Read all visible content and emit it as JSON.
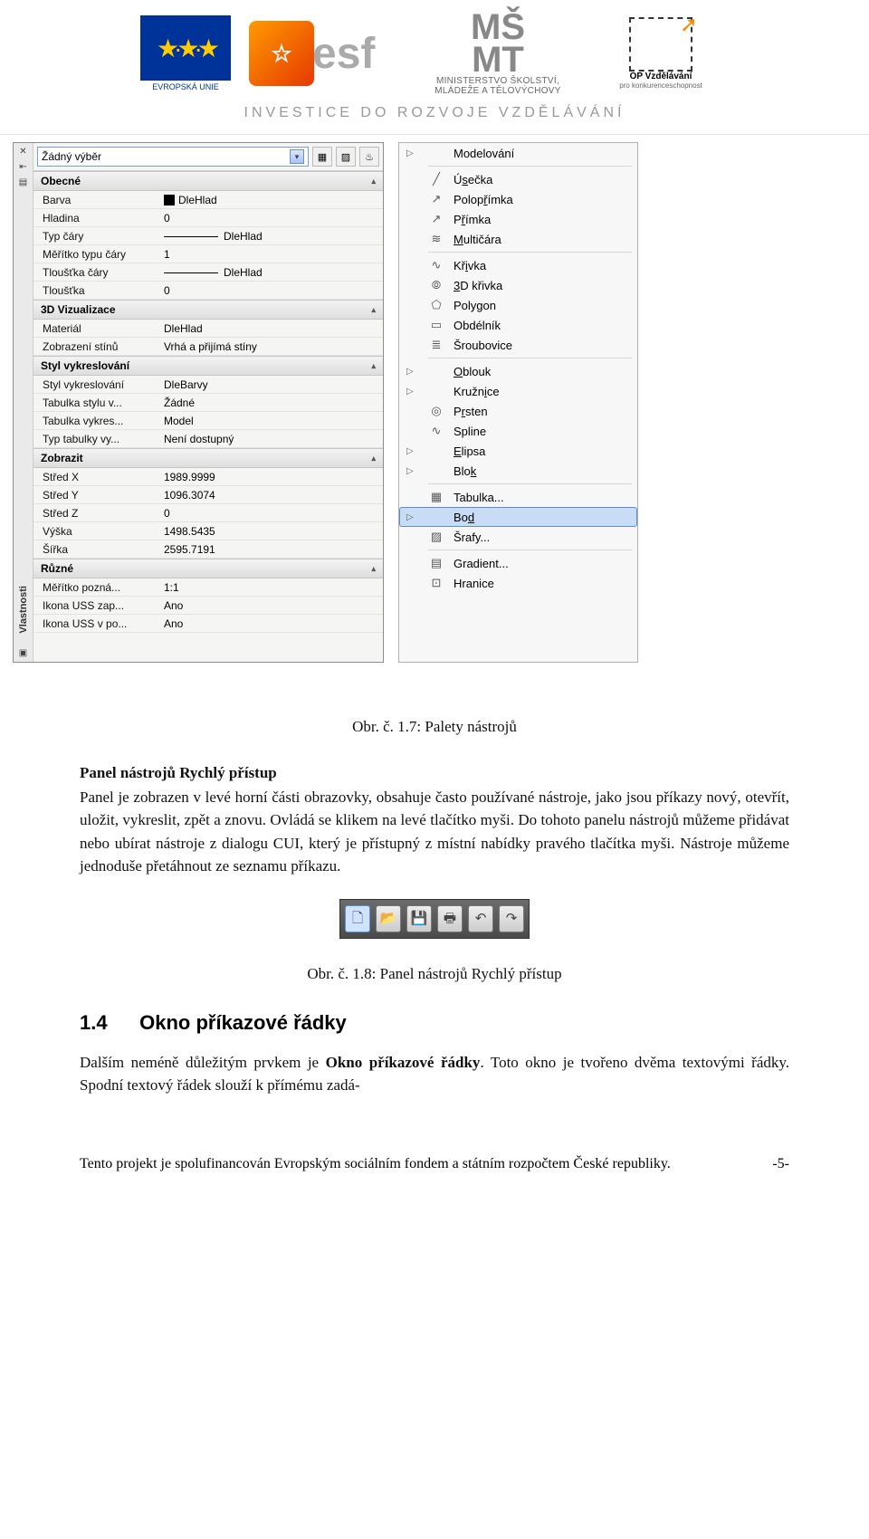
{
  "header": {
    "eu_label": "EVROPSKÁ UNIE",
    "msmt_line1": "MINISTERSTVO ŠKOLSTVÍ,",
    "msmt_line2": "MLÁDEŽE A TĚLOVÝCHOVY",
    "opvk_line1": "OP Vzdělávání",
    "opvk_line2": "pro konkurenceschopnost",
    "invest": "INVESTICE DO ROZVOJE VZDĚLÁVÁNÍ"
  },
  "props_panel": {
    "side_label": "Vlastnosti",
    "selection": "Žádný výběr",
    "categories": [
      {
        "name": "Obecné",
        "rows": [
          {
            "label": "Barva",
            "value": "DleHlad",
            "swatch": true
          },
          {
            "label": "Hladina",
            "value": "0"
          },
          {
            "label": "Typ čáry",
            "value": "DleHlad",
            "line": true
          },
          {
            "label": "Měřítko typu čáry",
            "value": "1"
          },
          {
            "label": "Tloušťka čáry",
            "value": "DleHlad",
            "line": true
          },
          {
            "label": "Tloušťka",
            "value": "0"
          }
        ]
      },
      {
        "name": "3D Vizualizace",
        "rows": [
          {
            "label": "Materiál",
            "value": "DleHlad"
          },
          {
            "label": "Zobrazení stínů",
            "value": "Vrhá a přijímá stíny"
          }
        ]
      },
      {
        "name": "Styl vykreslování",
        "rows": [
          {
            "label": "Styl vykreslování",
            "value": "DleBarvy"
          },
          {
            "label": "Tabulka stylu v...",
            "value": "Žádné"
          },
          {
            "label": "Tabulka vykres...",
            "value": "Model"
          },
          {
            "label": "Typ tabulky vy...",
            "value": "Není dostupný"
          }
        ]
      },
      {
        "name": "Zobrazit",
        "rows": [
          {
            "label": "Střed X",
            "value": "1989.9999"
          },
          {
            "label": "Střed Y",
            "value": "1096.3074"
          },
          {
            "label": "Střed Z",
            "value": "0"
          },
          {
            "label": "Výška",
            "value": "1498.5435"
          },
          {
            "label": "Šířka",
            "value": "2595.7191"
          }
        ]
      },
      {
        "name": "Různé",
        "rows": [
          {
            "label": "Měřítko pozná...",
            "value": "1:1"
          },
          {
            "label": "Ikona USS zap...",
            "value": "Ano"
          },
          {
            "label": "Ikona USS v po...",
            "value": "Ano"
          }
        ]
      }
    ]
  },
  "menu": {
    "items": [
      {
        "text": "Modelování",
        "expander": true,
        "icon": "▷"
      },
      {
        "sep": true
      },
      {
        "text": "Úsečka",
        "under": 1,
        "icon": "╱"
      },
      {
        "text": "Polopřímka",
        "under": 5,
        "icon": "↗"
      },
      {
        "text": "Přímka",
        "under": 1,
        "icon": "↗"
      },
      {
        "text": "Multičára",
        "under": 0,
        "icon": "≋"
      },
      {
        "sep": true
      },
      {
        "text": "Křivka",
        "under": 2,
        "icon": "∿"
      },
      {
        "text": "3D křivka",
        "under": 0,
        "icon": "⦾"
      },
      {
        "text": "Polygon",
        "icon": "⬠"
      },
      {
        "text": "Obdélník",
        "icon": "▭"
      },
      {
        "text": "Šroubovice",
        "icon": "≣"
      },
      {
        "sep": true
      },
      {
        "text": "Oblouk",
        "under": 0,
        "expander": true,
        "icon": "▷"
      },
      {
        "text": "Kružnice",
        "under": 5,
        "expander": true,
        "icon": "▷"
      },
      {
        "text": "Prsten",
        "under": 1,
        "icon": "◎"
      },
      {
        "text": "Spline",
        "icon": "∿"
      },
      {
        "text": "Elipsa",
        "under": 0,
        "expander": true,
        "icon": "▷"
      },
      {
        "text": "Blok",
        "under": 3,
        "expander": true,
        "icon": "▷"
      },
      {
        "sep": true
      },
      {
        "text": "Tabulka...",
        "icon": "▦"
      },
      {
        "text": "Bod",
        "under": 2,
        "expander": true,
        "hover": true,
        "icon": ""
      },
      {
        "text": "Šrafy...",
        "icon": "▨"
      },
      {
        "sep": true
      },
      {
        "text": "Gradient...",
        "icon": "▤"
      },
      {
        "text": "Hranice",
        "icon": "⊡"
      }
    ]
  },
  "content": {
    "caption1": "Obr. č. 1.7: Palety nástrojů",
    "head1": "Panel nástrojů Rychlý přístup",
    "para1": "Panel je zobrazen v levé horní části obrazovky, obsahuje často používané nástroje, jako jsou příkazy nový, otevřít, uložit, vykreslit, zpět a znovu. Ovládá se klikem na levé tlačítko myši. Do tohoto panelu nástrojů můžeme přidávat nebo ubírat nástroje z dialogu CUI, který je přístupný z místní nabídky pravého tlačítka myši. Nástroje můžeme jednoduše přetáhnout ze seznamu příkazu.",
    "caption2": "Obr. č. 1.8: Panel nástrojů Rychlý přístup",
    "sec_num": "1.4",
    "sec_title": "Okno příkazové řádky",
    "para2a": "Dalším neméně důležitým prvkem je ",
    "para2b": "Okno příkazové řádky",
    "para2c": ". Toto okno je tvořeno dvěma textovými řádky. Spodní textový řádek slouží k přímému zadá-",
    "footer_text": "Tento projekt je spolufinancován Evropským sociálním fondem a státním rozpočtem České republiky.",
    "page_num": "-5-"
  }
}
